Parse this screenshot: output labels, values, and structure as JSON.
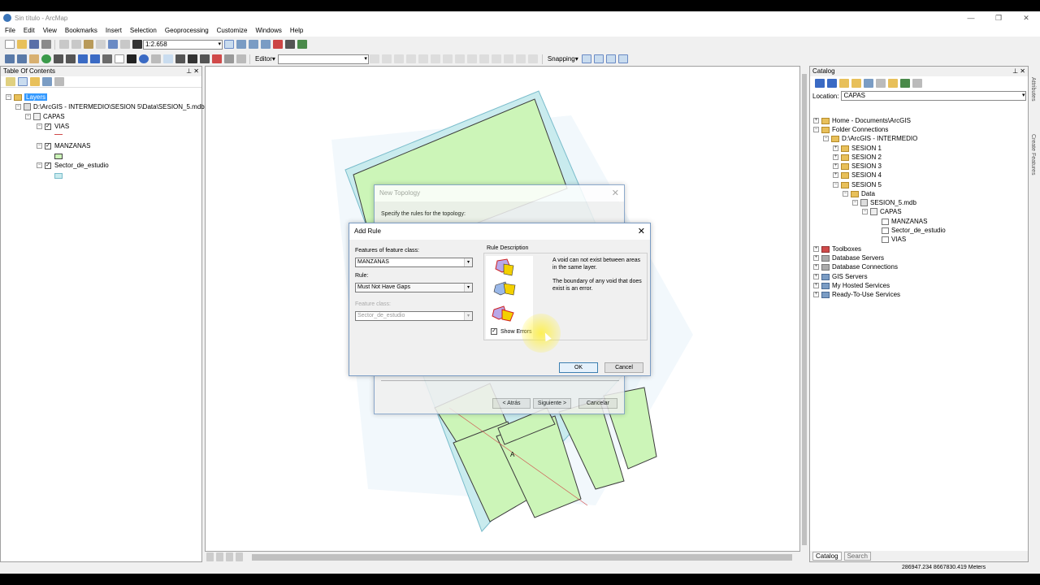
{
  "window": {
    "title": "Sin título - ArcMap",
    "minimize": "—",
    "maximize": "❐",
    "close": "✕"
  },
  "menu": [
    "File",
    "Edit",
    "View",
    "Bookmarks",
    "Insert",
    "Selection",
    "Geoprocessing",
    "Customize",
    "Windows",
    "Help"
  ],
  "toolbar": {
    "scale": "1:2.658",
    "editor": "Editor▾",
    "snapping": "Snapping▾"
  },
  "toc": {
    "title": "Table Of Contents",
    "pin": "⊥",
    "close": "✕",
    "layers": "Layers",
    "path": "D:\\ArcGIS - INTERMEDIO\\SESION 5\\Data\\SESION_5.mdb",
    "group": "CAPAS",
    "items": [
      "VIAS",
      "MANZANAS",
      "Sector_de_estudio"
    ]
  },
  "catalog": {
    "title": "Catalog",
    "pin": "⊥",
    "close": "✕",
    "location_label": "Location:",
    "location_value": "CAPAS",
    "tree": [
      "Home - Documents\\ArcGIS",
      "Folder Connections",
      "D:\\ArcGIS - INTERMEDIO",
      "SESION 1",
      "SESION 2",
      "SESION 3",
      "SESION 4",
      "SESION 5",
      "Data",
      "SESION_5.mdb",
      "CAPAS",
      "MANZANAS",
      "Sector_de_estudio",
      "VIAS",
      "Toolboxes",
      "Database Servers",
      "Database Connections",
      "GIS Servers",
      "My Hosted Services",
      "Ready-To-Use Services"
    ],
    "tabs": [
      "Catalog",
      "Search"
    ],
    "side_tabs": [
      "Attributes",
      "Create Features"
    ]
  },
  "new_topology": {
    "title": "New Topology",
    "instruction": "Specify the rules for the topology:",
    "back": "< Atrás",
    "next": "Siguiente >",
    "cancel": "Cancelar"
  },
  "add_rule": {
    "title": "Add Rule",
    "features_label": "Features of feature class:",
    "features_value": "MANZANAS",
    "rule_label": "Rule:",
    "rule_value": "Must Not Have Gaps",
    "feature_class_label": "Feature class:",
    "feature_class_value": "Sector_de_estudio",
    "rule_desc_label": "Rule Description",
    "desc1": "A void can not exist between areas in the same layer.",
    "desc2": "The boundary of any void that does exist is an error.",
    "show_errors": "Show Errors",
    "ok": "OK",
    "cancel": "Cancel"
  },
  "map": {
    "label_a": "A"
  },
  "status": {
    "coords": "286947.234  8667830.419 Meters"
  },
  "colors": {
    "parcel_fill": "#ccf5b8",
    "road_fill": "#c9ebee",
    "parcel_stroke": "#3c3c3c",
    "road_stroke": "#7abccb"
  }
}
